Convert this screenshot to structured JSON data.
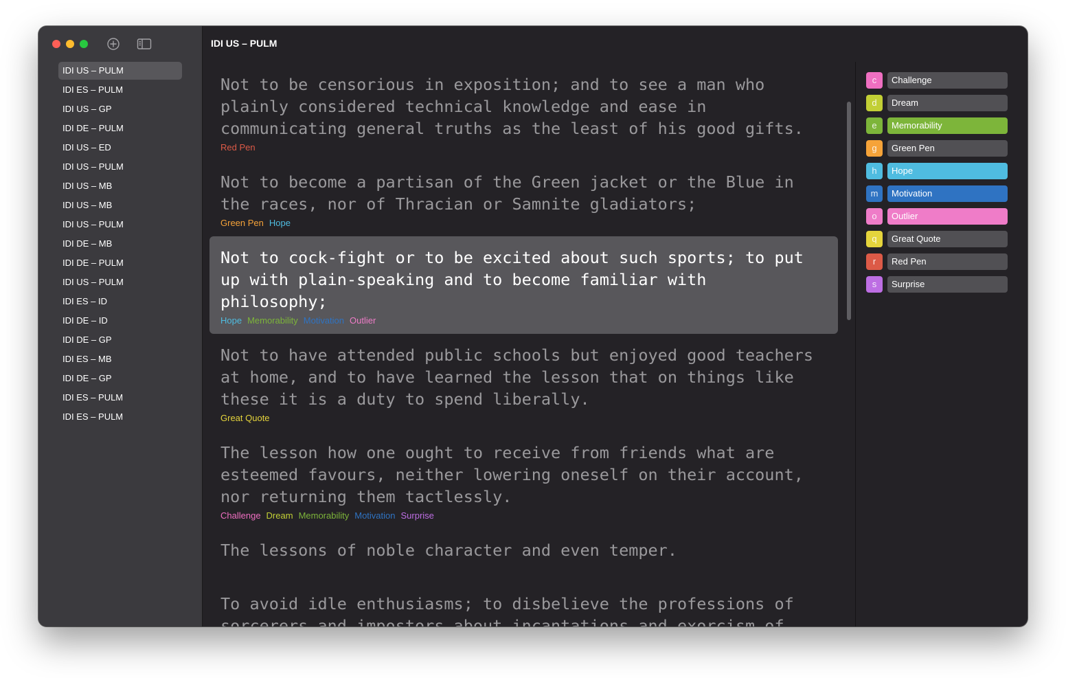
{
  "window": {
    "title": "IDI US – PULM"
  },
  "colors": {
    "challenge": "#ef6fc1",
    "dream": "#c2cf35",
    "memorability": "#7db53a",
    "green_pen": "#f6a339",
    "hope": "#4fbce0",
    "motivation": "#2f73c2",
    "outlier": "#ef7cc8",
    "great_quote": "#e5d43c",
    "red_pen": "#dc5a47",
    "surprise": "#bd6ee3"
  },
  "sidebar": {
    "items": [
      {
        "label": "IDI US – PULM"
      },
      {
        "label": "IDI ES – PULM"
      },
      {
        "label": "IDI US – GP"
      },
      {
        "label": "IDI DE – PULM"
      },
      {
        "label": "IDI US – ED"
      },
      {
        "label": "IDI US – PULM"
      },
      {
        "label": "IDI US – MB"
      },
      {
        "label": "IDI US – MB"
      },
      {
        "label": "IDI US – PULM"
      },
      {
        "label": "IDI DE – MB"
      },
      {
        "label": "IDI DE – PULM"
      },
      {
        "label": "IDI US – PULM"
      },
      {
        "label": "IDI ES – ID"
      },
      {
        "label": "IDI DE – ID"
      },
      {
        "label": "IDI DE – GP"
      },
      {
        "label": "IDI ES – MB"
      },
      {
        "label": "IDI DE – GP"
      },
      {
        "label": "IDI ES – PULM"
      },
      {
        "label": "IDI ES – PULM"
      }
    ]
  },
  "paragraphs": [
    {
      "text": "Not to be censorious in exposition; and to see a man who\nplainly considered technical knowledge and ease in\ncommunicating general truths as the least of his good gifts.",
      "tags": [
        {
          "label": "Red Pen",
          "color": "#dc5a47"
        }
      ]
    },
    {
      "text": "Not to become a partisan of the Green jacket or the Blue in\nthe races, nor of Thracian or Samnite gladiators;",
      "tags": [
        {
          "label": "Green Pen",
          "color": "#f6a339"
        },
        {
          "label": "Hope",
          "color": "#4fbce0"
        }
      ]
    },
    {
      "text": "Not to cock-fight or to be excited about such sports; to put\nup with plain-speaking and to become familiar with\nphilosophy;",
      "tags": [
        {
          "label": "Hope",
          "color": "#4fbce0"
        },
        {
          "label": "Memorability",
          "color": "#7db53a"
        },
        {
          "label": "Motivation",
          "color": "#2f73c2"
        },
        {
          "label": "Outlier",
          "color": "#ef7cc8"
        }
      ]
    },
    {
      "text": "Not to have attended public schools but enjoyed good teachers\nat home, and to have learned the lesson that on things like\nthese it is a duty to spend liberally.",
      "tags": [
        {
          "label": "Great Quote",
          "color": "#e5d43c"
        }
      ]
    },
    {
      "text": "The lesson how one ought to receive from friends what are\nesteemed favours, neither lowering oneself on their account,\nnor returning them tactlessly.",
      "tags": [
        {
          "label": "Challenge",
          "color": "#ef6fc1"
        },
        {
          "label": "Dream",
          "color": "#c2cf35"
        },
        {
          "label": "Memorability",
          "color": "#7db53a"
        },
        {
          "label": "Motivation",
          "color": "#2f73c2"
        },
        {
          "label": "Surprise",
          "color": "#bd6ee3"
        }
      ]
    },
    {
      "text": "The lessons of noble character and even temper.",
      "tags": []
    },
    {
      "text": "To avoid idle enthusiasms; to disbelieve the professions of\nsorcerers and impostors about incantations and exorcism of\nspirits and the like;",
      "tags": []
    }
  ],
  "labels": [
    {
      "key": "c",
      "name": "Challenge",
      "color": "#ef6fc1",
      "active": false
    },
    {
      "key": "d",
      "name": "Dream",
      "color": "#c2cf35",
      "active": false
    },
    {
      "key": "e",
      "name": "Memorability",
      "color": "#7db53a",
      "active": true
    },
    {
      "key": "g",
      "name": "Green Pen",
      "color": "#f6a339",
      "active": false
    },
    {
      "key": "h",
      "name": "Hope",
      "color": "#4fbce0",
      "active": true
    },
    {
      "key": "m",
      "name": "Motivation",
      "color": "#2f73c2",
      "active": true
    },
    {
      "key": "o",
      "name": "Outlier",
      "color": "#ef7cc8",
      "active": true
    },
    {
      "key": "q",
      "name": "Great Quote",
      "color": "#e5d43c",
      "active": false
    },
    {
      "key": "r",
      "name": "Red Pen",
      "color": "#dc5a47",
      "active": false
    },
    {
      "key": "s",
      "name": "Surprise",
      "color": "#bd6ee3",
      "active": false
    }
  ],
  "selected_paragraph": 2,
  "active_document": 0,
  "icons": {
    "new_document": "plus-circle-icon",
    "toggle_sidebar": "sidebar-toggle-icon"
  }
}
